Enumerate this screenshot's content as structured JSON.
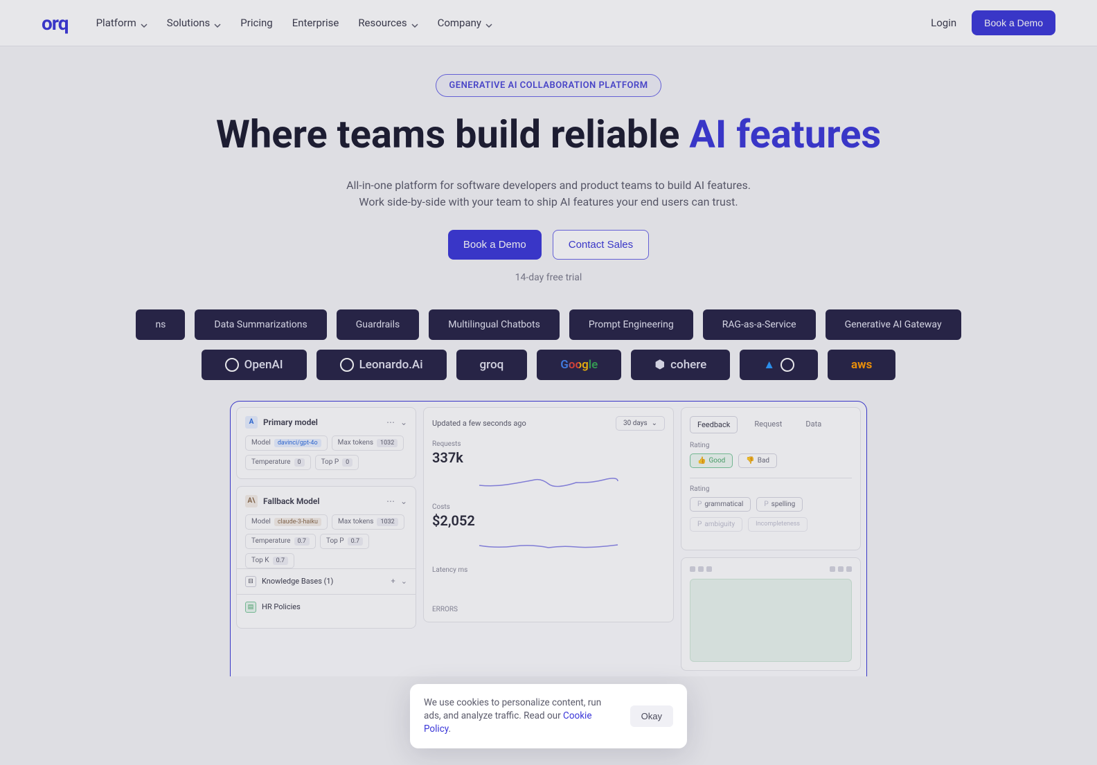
{
  "header": {
    "logo": "orq",
    "nav": [
      "Platform",
      "Solutions",
      "Pricing",
      "Enterprise",
      "Resources",
      "Company"
    ],
    "nav_dropdowns": [
      true,
      true,
      false,
      false,
      true,
      true
    ],
    "login": "Login",
    "cta": "Book a Demo"
  },
  "hero": {
    "badge": "GENERATIVE AI COLLABORATION PLATFORM",
    "title_a": "Where teams build reliable ",
    "title_b": "AI features",
    "sub1": "All-in-one platform for software developers and product teams to build AI features.",
    "sub2": "Work side-by-side with your team to ship AI features your end users can trust.",
    "cta_primary": "Book a Demo",
    "cta_secondary": "Contact Sales",
    "trial": "14-day free trial"
  },
  "chips": [
    "ns",
    "Data Summarizations",
    "Guardrails",
    "Multilingual Chatbots",
    "Prompt Engineering",
    "RAG-as-a-Service",
    "Generative AI Gateway"
  ],
  "logos": [
    "OpenAI",
    "Leonardo.Ai",
    "groq",
    "Google",
    "cohere",
    "",
    "aws"
  ],
  "dashboard": {
    "primary": {
      "title": "Primary model",
      "model_label": "Model",
      "model_value": "davinci/gpt-4o",
      "max_tokens": "Max tokens",
      "max_tokens_val": "1032",
      "temp": "Temperature",
      "temp_val": "0",
      "topp": "Top P",
      "topp_val": "0"
    },
    "fallback": {
      "title": "Fallback Model",
      "model_label": "Model",
      "model_value": "claude-3-haiku",
      "max_tokens": "Max tokens",
      "max_tokens_val": "1032",
      "temp": "Temperature",
      "temp_val": "0.7",
      "topp": "Top P",
      "topp_val": "0.7",
      "topk": "Top K",
      "topk_val": "0.7",
      "kb": "Knowledge Bases (1)",
      "kb_item": "HR Policies"
    },
    "metrics": {
      "updated": "Updated a few seconds ago",
      "range": "30 days",
      "requests_label": "Requests",
      "requests": "337k",
      "costs_label": "Costs",
      "costs": "$2,052",
      "latency_label": "Latency ms",
      "errors_label": "ERRORS"
    },
    "feedback": {
      "tabs": [
        "Feedback",
        "Request",
        "Data"
      ],
      "rating_label": "Rating",
      "good": "Good",
      "bad": "Bad",
      "tags": [
        "grammatical",
        "spelling",
        "ambiguity",
        "Incompleteness"
      ]
    }
  },
  "cookie": {
    "text": "We use cookies to personalize content, run ads, and analyze traffic. Read our ",
    "link": "Cookie Policy",
    "ok": "Okay"
  }
}
